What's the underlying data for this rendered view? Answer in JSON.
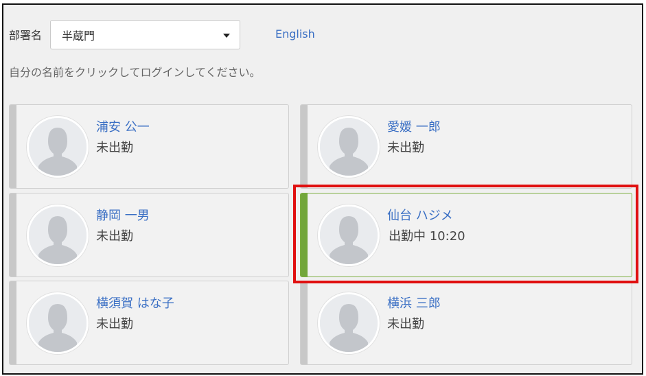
{
  "department": {
    "label": "部署名",
    "selected": "半蔵門"
  },
  "language_link": "English",
  "instruction": "自分の名前をクリックしてログインしてください。",
  "employees": [
    {
      "name": "浦安 公一",
      "status": "未出勤",
      "active": false
    },
    {
      "name": "愛媛 一郎",
      "status": "未出勤",
      "active": false
    },
    {
      "name": "静岡 一男",
      "status": "未出勤",
      "active": false
    },
    {
      "name": "仙台 ハジメ",
      "status": "出勤中 10:20",
      "active": true
    },
    {
      "name": "横須賀 はな子",
      "status": "未出勤",
      "active": false
    },
    {
      "name": "横浜 三郎",
      "status": "未出勤",
      "active": false
    }
  ],
  "colors": {
    "link": "#3a6fc4",
    "active_stripe": "#72a63a",
    "highlight": "#e01010"
  },
  "icons": {
    "avatar": "person-silhouette-icon",
    "dropdown": "chevron-down-icon"
  }
}
